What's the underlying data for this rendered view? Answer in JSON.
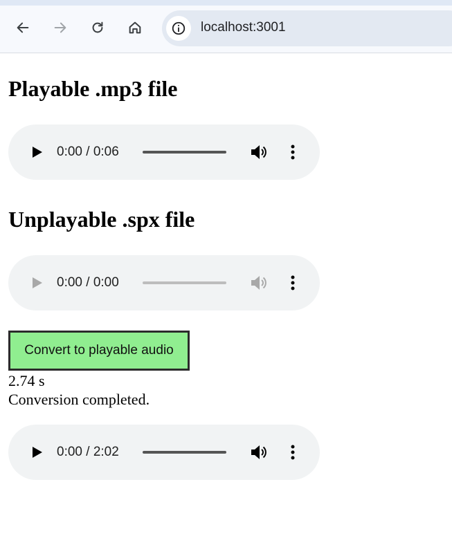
{
  "browser": {
    "url": "localhost:3001",
    "icons": [
      "back-arrow-icon",
      "forward-arrow-icon",
      "reload-icon",
      "home-icon",
      "site-info-icon"
    ]
  },
  "page": {
    "heading1": "Playable .mp3 file",
    "player1": {
      "time": "0:00 / 0:06",
      "enabled": true
    },
    "heading2": "Unplayable .spx file",
    "player2": {
      "time": "0:00 / 0:00",
      "enabled": false
    },
    "convert_button": "Convert to playable audio",
    "duration": "2.74 s",
    "status": "Conversion completed.",
    "player3": {
      "time": "0:00 / 2:02",
      "enabled": true
    }
  },
  "colors": {
    "button_bg": "#90ee90",
    "player_bg": "#f1f3f4",
    "toolbar_bg": "#f7f9fd"
  }
}
